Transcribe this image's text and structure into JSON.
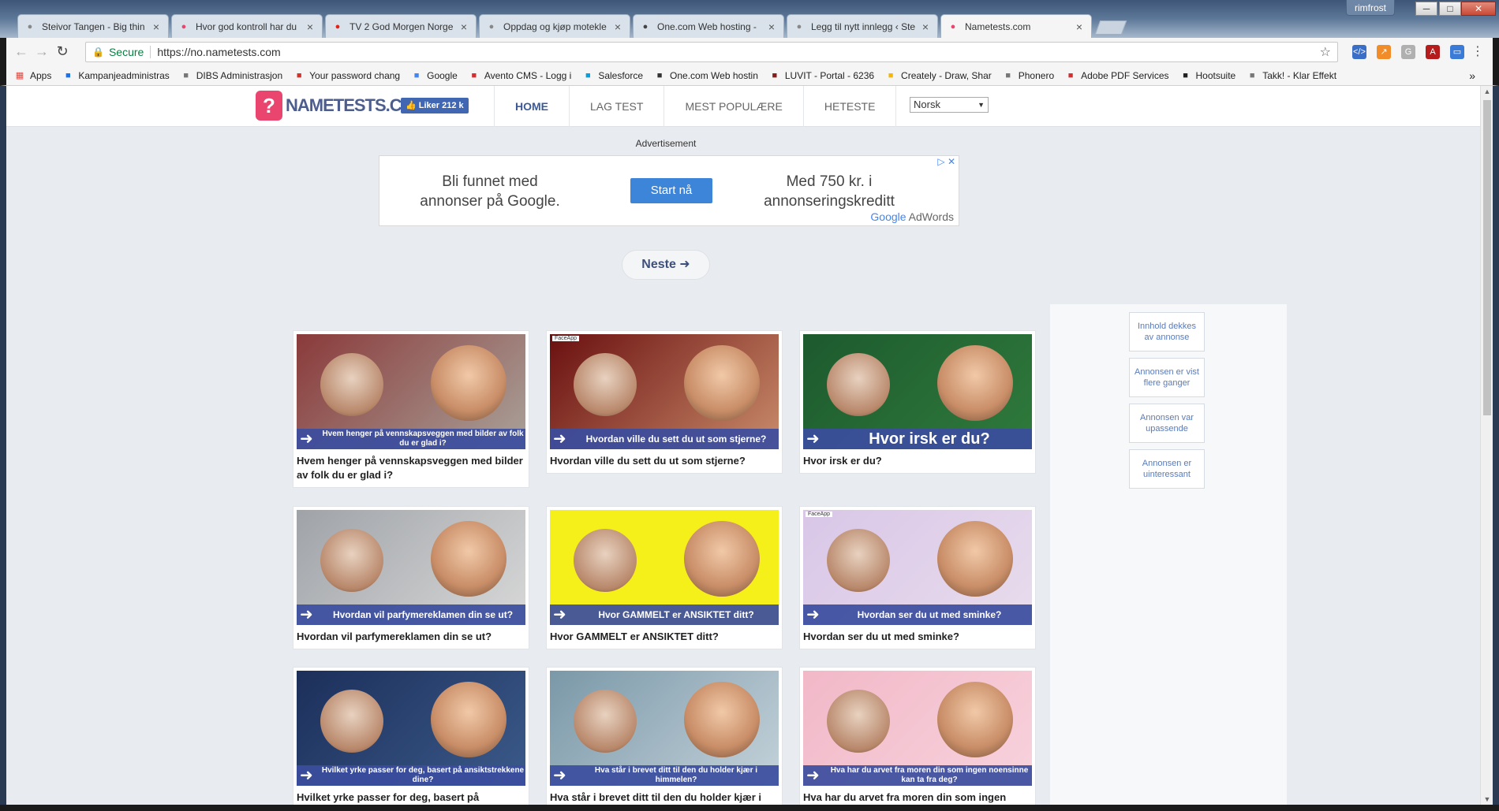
{
  "window": {
    "user": "rimfrost",
    "minimize": "─",
    "maximize": "□",
    "close": "✕"
  },
  "tabs": [
    {
      "title": "Steivor Tangen - Big thin",
      "icon_color": "#888888",
      "icon": "page-icon"
    },
    {
      "title": "Hvor god kontroll har du",
      "icon_color": "#e9456f",
      "icon": "nametests-icon"
    },
    {
      "title": "TV 2 God Morgen Norge",
      "icon_color": "#e62117",
      "icon": "youtube-icon"
    },
    {
      "title": "Oppdag og kjøp motekle",
      "icon_color": "#888888",
      "icon": "gear-icon"
    },
    {
      "title": "One.com Web hosting -",
      "icon_color": "#444444",
      "icon": "onecom-icon"
    },
    {
      "title": "Legg til nytt innlegg ‹ Ste",
      "icon_color": "#888888",
      "icon": "page-icon"
    },
    {
      "title": "Nametests.com",
      "icon_color": "#e9456f",
      "icon": "nametests-icon"
    }
  ],
  "toolbar": {
    "back": "←",
    "forward": "→",
    "reload": "↻",
    "secure_label": "Secure",
    "url": "https://no.nametests.com",
    "star": "☆"
  },
  "bookmarks": [
    {
      "label": "Apps",
      "icon": "apps-grid-icon",
      "color": "#e8453c"
    },
    {
      "label": "Kampanjeadministras",
      "icon": "adwords-icon",
      "color": "#1a73e8"
    },
    {
      "label": "DIBS Administrasjon",
      "icon": "dibs-icon",
      "color": "#777777"
    },
    {
      "label": "Your password chang",
      "icon": "gmail-icon",
      "color": "#d93025"
    },
    {
      "label": "Google",
      "icon": "google-icon",
      "color": "#4285f4"
    },
    {
      "label": "Avento CMS - Logg i",
      "icon": "avento-icon",
      "color": "#d32f2f"
    },
    {
      "label": "Salesforce",
      "icon": "salesforce-icon",
      "color": "#00a1e0"
    },
    {
      "label": "One.com Web hostin",
      "icon": "onecom-icon",
      "color": "#333333"
    },
    {
      "label": "LUVIT - Portal - 6236",
      "icon": "luvit-icon",
      "color": "#8b1a1a"
    },
    {
      "label": "Creately - Draw, Shar",
      "icon": "creately-icon",
      "color": "#f5b700"
    },
    {
      "label": "Phonero",
      "icon": "page-icon",
      "color": "#777777"
    },
    {
      "label": "Adobe PDF Services",
      "icon": "adobe-icon",
      "color": "#d32f2f"
    },
    {
      "label": "Hootsuite",
      "icon": "hootsuite-icon",
      "color": "#222222"
    },
    {
      "label": "Takk! - Klar Effekt",
      "icon": "page-icon",
      "color": "#777777"
    }
  ],
  "bookmarks_more": "»",
  "site": {
    "logo_mark": "?",
    "logo_text": "NAMETESTS.COM",
    "like_label": "👍 Liker 212 k",
    "nav": [
      {
        "label": "Home",
        "active": true
      },
      {
        "label": "Lag test",
        "active": false
      },
      {
        "label": "Mest populære",
        "active": false
      },
      {
        "label": "Heteste",
        "active": false
      }
    ],
    "language": "Norsk"
  },
  "ad": {
    "label": "Advertisement",
    "left_text": "Bli funnet med annonser på Google.",
    "cta": "Start nå",
    "right_text": "Med 750 kr. i annonseringskreditt",
    "brand_google": "Google",
    "brand_adwords": " AdWords",
    "close": "▷ ✕"
  },
  "next_button": "Neste ➜",
  "ad_feedback": [
    "Innhold dekkes av annonse",
    "Annonsen er vist flere ganger",
    "Annonsen var upassende",
    "Annonsen er uinteressant"
  ],
  "cards": [
    {
      "banner": "Hvem henger på vennskapsveggen med bilder av folk du er glad i?",
      "caption": "Hvem henger på vennskapsveggen med bilder av folk du er glad i?",
      "bg": "#8a3a3a",
      "bg2": "#a9a29a",
      "faceapp": false
    },
    {
      "banner": "Hvordan ville du sett du ut som stjerne?",
      "caption": "Hvordan ville du sett du ut som stjerne?",
      "bg": "#6a1010",
      "bg2": "#c98b6a",
      "faceapp": true
    },
    {
      "banner": "Hvor irsk er du?",
      "caption": "Hvor irsk er du?",
      "bg": "#1d5a2e",
      "bg2": "#2f7a3c",
      "faceapp": false
    },
    {
      "banner": "Hvordan vil parfymereklamen din se ut?",
      "caption": "Hvordan vil parfymereklamen din se ut?",
      "bg": "#9fa3a8",
      "bg2": "#d8d8d8",
      "faceapp": false
    },
    {
      "banner": "Hvor GAMMELT er ANSIKTET ditt?",
      "caption": "Hvor GAMMELT er ANSIKTET ditt?",
      "bg": "#f5ef1a",
      "bg2": "#f5ef1a",
      "faceapp": false
    },
    {
      "banner": "Hvordan ser du ut med sminke?",
      "caption": "Hvordan ser du ut med sminke?",
      "bg": "#d9c6e8",
      "bg2": "#e8dcec",
      "faceapp": true
    },
    {
      "banner": "Hvilket yrke passer for deg, basert på ansiktstrekkene dine?",
      "caption": "Hvilket yrke passer for deg, basert på",
      "bg": "#1c2f5a",
      "bg2": "#3b5a8a",
      "faceapp": false
    },
    {
      "banner": "Hva står i brevet ditt til den du holder kjær i himmelen?",
      "caption": "Hva står i brevet ditt til den du holder kjær i",
      "bg": "#7a98a8",
      "bg2": "#c4d2da",
      "faceapp": false
    },
    {
      "banner": "Hva har du arvet fra moren din som ingen noensinne kan ta fra deg?",
      "caption": "Hva har du arvet fra moren din som ingen",
      "bg": "#f2b8c8",
      "bg2": "#f7d2dc",
      "faceapp": false
    }
  ]
}
